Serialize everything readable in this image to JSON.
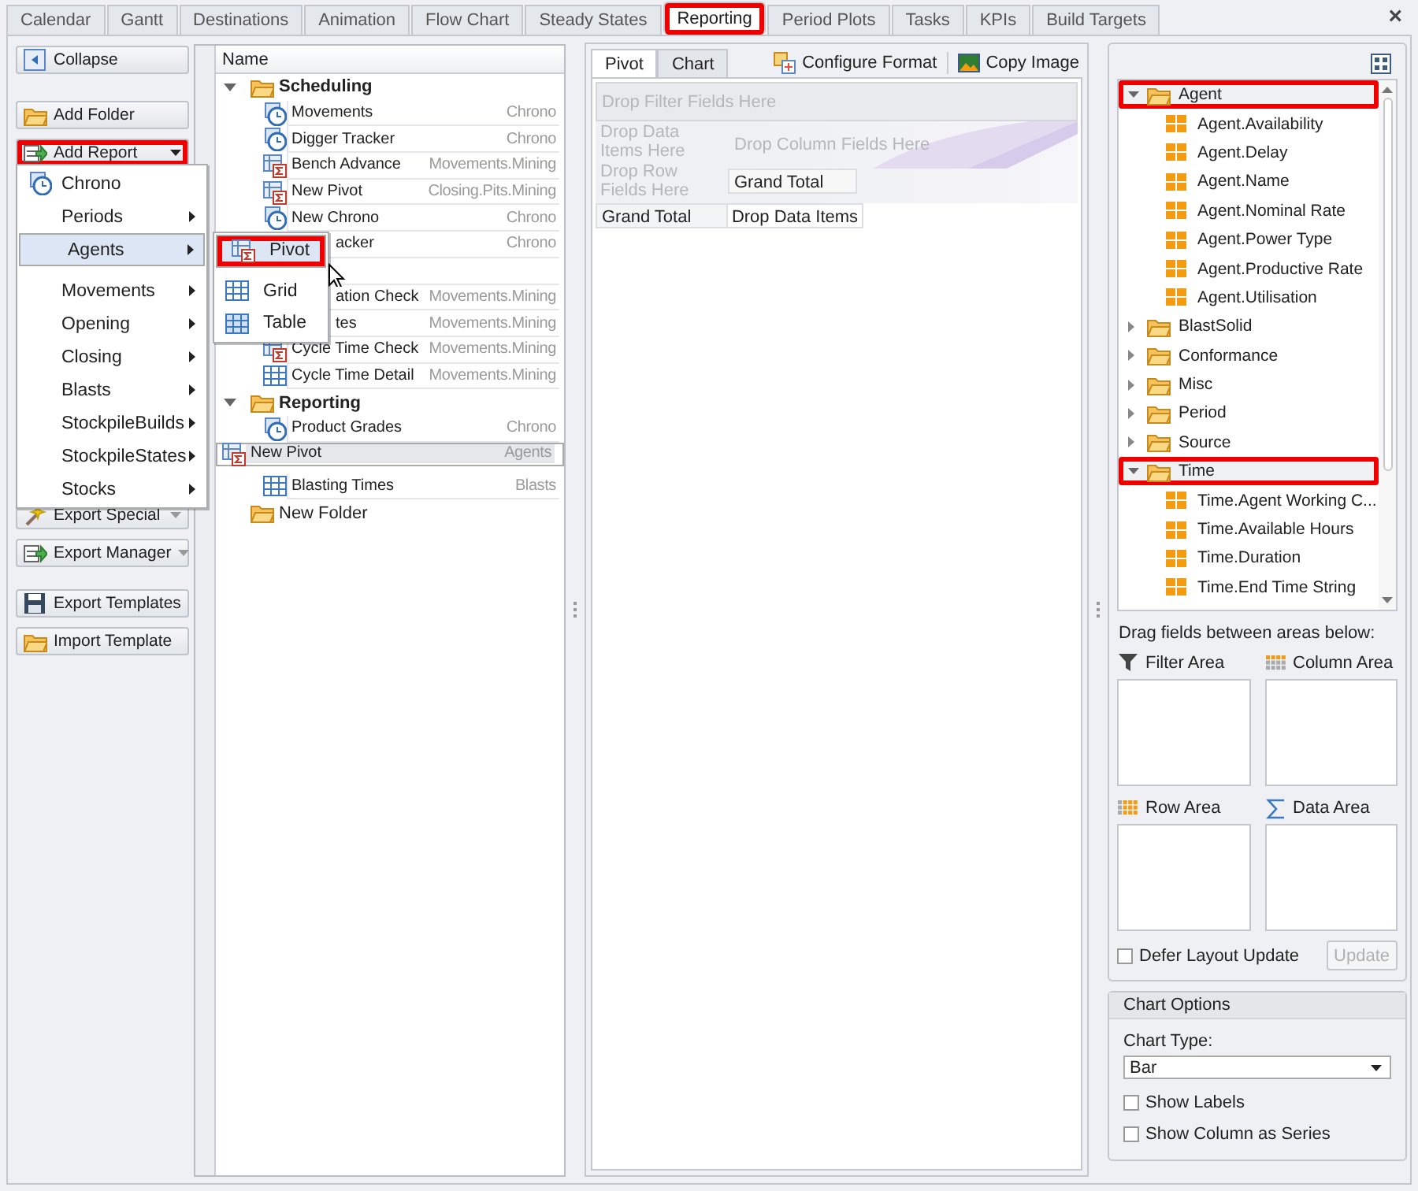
{
  "tabs": [
    {
      "label": "Calendar",
      "selected": false,
      "highlighted": false
    },
    {
      "label": "Gantt",
      "selected": false,
      "highlighted": false
    },
    {
      "label": "Destinations",
      "selected": false,
      "highlighted": false
    },
    {
      "label": "Animation",
      "selected": false,
      "highlighted": false
    },
    {
      "label": "Flow Chart",
      "selected": false,
      "highlighted": false
    },
    {
      "label": "Steady States",
      "selected": false,
      "highlighted": false
    },
    {
      "label": "Reporting",
      "selected": true,
      "highlighted": true
    },
    {
      "label": "Period Plots",
      "selected": false,
      "highlighted": false
    },
    {
      "label": "Tasks",
      "selected": false,
      "highlighted": false
    },
    {
      "label": "KPIs",
      "selected": false,
      "highlighted": false
    },
    {
      "label": "Build Targets",
      "selected": false,
      "highlighted": false
    }
  ],
  "close_glyph": "×",
  "sidebar": {
    "groups": [
      [
        {
          "label": "Collapse",
          "dropdown": false,
          "highlighted": false
        }
      ],
      [
        {
          "label": "Add Folder",
          "dropdown": false,
          "highlighted": false
        },
        {
          "label": "Add Report",
          "dropdown": true,
          "highlighted": true
        }
      ],
      [
        {
          "label": "Export Special",
          "dropdown": true,
          "highlighted": false
        },
        {
          "label": "Export Manager",
          "dropdown": true,
          "highlighted": false
        }
      ],
      [
        {
          "label": "Export Templates",
          "dropdown": false,
          "highlighted": false
        },
        {
          "label": "Import Template",
          "dropdown": false,
          "highlighted": false
        }
      ]
    ]
  },
  "tree": {
    "columns": [
      "Name"
    ],
    "items": [
      {
        "name": "Scheduling",
        "expanded": true,
        "children": [
          {
            "name": "Movements",
            "kind": "chrono",
            "type": "Chrono",
            "selected": false
          },
          {
            "name": "Digger Tracker",
            "kind": "chrono",
            "type": "Chrono",
            "selected": false
          },
          {
            "name": "Bench Advance",
            "kind": "pivot",
            "type": "Movements.Mining",
            "selected": false
          },
          {
            "name": "New Pivot",
            "kind": "pivot",
            "type": "Closing.Pits.Mining",
            "selected": false
          },
          {
            "name": "New Chrono",
            "kind": "chrono",
            "type": "Chrono",
            "selected": false
          },
          {
            "name": "acker",
            "kind": "covered",
            "type": "Chrono",
            "selected": false
          },
          {
            "kind": "covered",
            "selected": false
          },
          {
            "name": "ation Check",
            "kind": "covered",
            "type": "Movements.Mining",
            "selected": false
          },
          {
            "name": "tes",
            "kind": "covered",
            "type": "Movements.Mining",
            "selected": false
          },
          {
            "name": "Cycle Time Check",
            "kind": "pivot",
            "type": "Movements.Mining",
            "selected": false
          },
          {
            "name": "Cycle Time Detail",
            "kind": "grid",
            "type": "Movements.Mining",
            "selected": false
          }
        ]
      },
      {
        "name": "Reporting",
        "expanded": true,
        "children": [
          {
            "name": "Product Grades",
            "kind": "chrono",
            "type": "Chrono",
            "selected": false
          },
          {
            "name": "New Pivot",
            "kind": "pivot",
            "type": "Agents",
            "selected": true
          },
          {
            "name": "Blasting Times",
            "kind": "grid",
            "type": "Blasts",
            "selected": false
          }
        ]
      },
      {
        "name": "New Folder",
        "expanded": false
      }
    ]
  },
  "add_report_menu": {
    "items": [
      {
        "label": "Chrono",
        "submenu": false,
        "selected": false
      },
      {
        "label": "Periods",
        "submenu": true,
        "selected": false
      },
      {
        "label": "Agents",
        "submenu": true,
        "selected": true
      },
      {
        "label": "Movements",
        "submenu": true,
        "selected": false
      },
      {
        "label": "Opening",
        "submenu": true,
        "selected": false
      },
      {
        "label": "Closing",
        "submenu": true,
        "selected": false
      },
      {
        "label": "Blasts",
        "submenu": true,
        "selected": false
      },
      {
        "label": "StockpileBuilds",
        "submenu": true,
        "selected": false
      },
      {
        "label": "StockpileStates",
        "submenu": true,
        "selected": false
      },
      {
        "label": "Stocks",
        "submenu": true,
        "selected": false
      }
    ]
  },
  "agents_submenu": {
    "items": [
      {
        "label": "Pivot",
        "selected": true,
        "highlighted": true
      },
      {
        "label": "Grid",
        "selected": false,
        "highlighted": false
      },
      {
        "label": "Table",
        "selected": false,
        "highlighted": false
      }
    ]
  },
  "view_tabs": [
    {
      "label": "Pivot",
      "selected": true
    },
    {
      "label": "Chart",
      "selected": false
    }
  ],
  "toolbar": [
    "Configure Format",
    "Copy Image"
  ],
  "pivot": {
    "filter_hint": "Drop Filter Fields Here",
    "data_hint": "Drop Data Items Here",
    "column_hint": "Drop Column Fields Here",
    "row_hint": "Drop Row Fields Here",
    "column_total": "Grand Total",
    "row_total": "Grand Total",
    "data_cell": "Drop Data Items"
  },
  "field_list": {
    "items": [
      {
        "name": "Agent",
        "expanded": true,
        "highlighted": true,
        "children": [
          "Agent.Availability",
          "Agent.Delay",
          "Agent.Name",
          "Agent.Nominal Rate",
          "Agent.Power Type",
          "Agent.Productive Rate",
          "Agent.Utilisation"
        ]
      },
      {
        "name": "BlastSolid",
        "expanded": false,
        "highlighted": false
      },
      {
        "name": "Conformance",
        "expanded": false,
        "highlighted": false
      },
      {
        "name": "Misc",
        "expanded": false,
        "highlighted": false
      },
      {
        "name": "Period",
        "expanded": false,
        "highlighted": false
      },
      {
        "name": "Source",
        "expanded": false,
        "highlighted": false
      },
      {
        "name": "Time",
        "expanded": true,
        "highlighted": true,
        "children": [
          "Time.Agent Working C...",
          "Time.Available Hours",
          "Time.Duration",
          "Time.End Time String"
        ]
      }
    ]
  },
  "areas": {
    "hint": "Drag fields between areas below:",
    "list": [
      {
        "label": "Filter Area",
        "kind": "filter"
      },
      {
        "label": "Column Area",
        "kind": "column"
      },
      {
        "label": "Row Area",
        "kind": "row"
      },
      {
        "label": "Data Area",
        "kind": "data"
      }
    ]
  },
  "defer_update": {
    "label": "Defer Layout Update",
    "checked": false
  },
  "update_button": {
    "label": "Update",
    "disabled": true
  },
  "chart_options": {
    "title": "Chart Options",
    "type_label": "Chart Type:",
    "type_value": "Bar",
    "options": [
      {
        "label": "Show Labels",
        "checked": false
      },
      {
        "label": "Show Column as Series",
        "checked": false
      }
    ]
  }
}
